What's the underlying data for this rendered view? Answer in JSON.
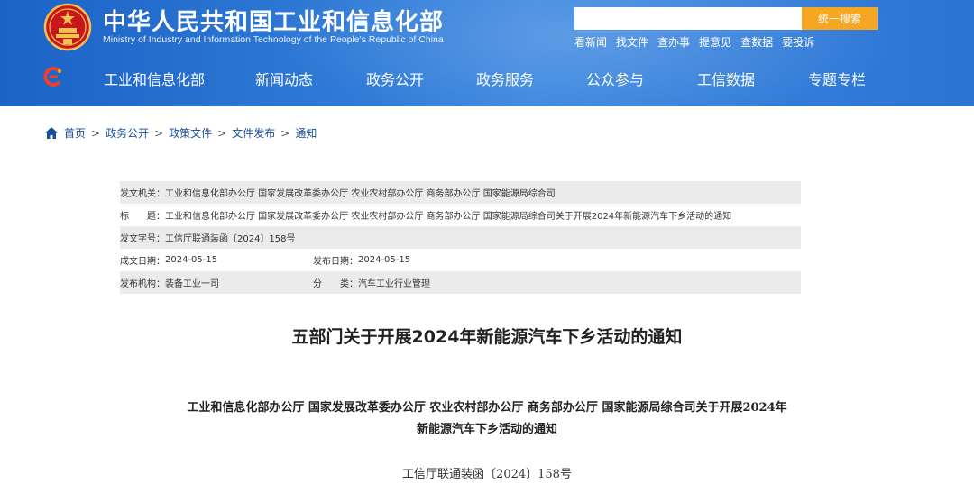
{
  "header": {
    "title": "中华人民共和国工业和信息化部",
    "subtitle": "Ministry of Industry and Information Technology of the People's Republic of China",
    "search": {
      "placeholder": "",
      "button_label": "统一搜索"
    },
    "quick_links": [
      "看新闻",
      "找文件",
      "查办事",
      "提意见",
      "查数据",
      "要投诉"
    ],
    "colors": {
      "brand_blue": "#2c74d4",
      "search_button": "#f5a623"
    }
  },
  "nav": {
    "items": [
      "工业和信息化部",
      "新闻动态",
      "政务公开",
      "政务服务",
      "公众参与",
      "工信数据",
      "专题专栏"
    ]
  },
  "breadcrumb": {
    "items": [
      "首页",
      "政务公开",
      "政策文件",
      "文件发布",
      "通知"
    ],
    "separator": ">"
  },
  "info": {
    "issuer": {
      "label": "发文机关：",
      "value": "工业和信息化部办公厅 国家发展改革委办公厅 农业农村部办公厅 商务部办公厅 国家能源局综合司"
    },
    "title": {
      "label": "标　　题：",
      "value": "工业和信息化部办公厅 国家发展改革委办公厅 农业农村部办公厅 商务部办公厅 国家能源局综合司关于开展2024年新能源汽车下乡活动的通知"
    },
    "doc_number": {
      "label": "发文字号：",
      "value": "工信厅联通装函〔2024〕158号"
    },
    "created": {
      "label": "成文日期：",
      "value": "2024-05-15"
    },
    "published": {
      "label": "发布日期：",
      "value": "2024-05-15"
    },
    "agency": {
      "label": "发布机构：",
      "value": "装备工业一司"
    },
    "category": {
      "label": "分　　类：",
      "value": "汽车工业行业管理"
    }
  },
  "article": {
    "title": "五部门关于开展2024年新能源汽车下乡活动的通知",
    "heading_line1": "工业和信息化部办公厅 国家发展改革委办公厅 农业农村部办公厅 商务部办公厅 国家能源局综合司关于开展2024年",
    "heading_line2": "新能源汽车下乡活动的通知",
    "doc_number": "工信厅联通装函〔2024〕158号"
  }
}
